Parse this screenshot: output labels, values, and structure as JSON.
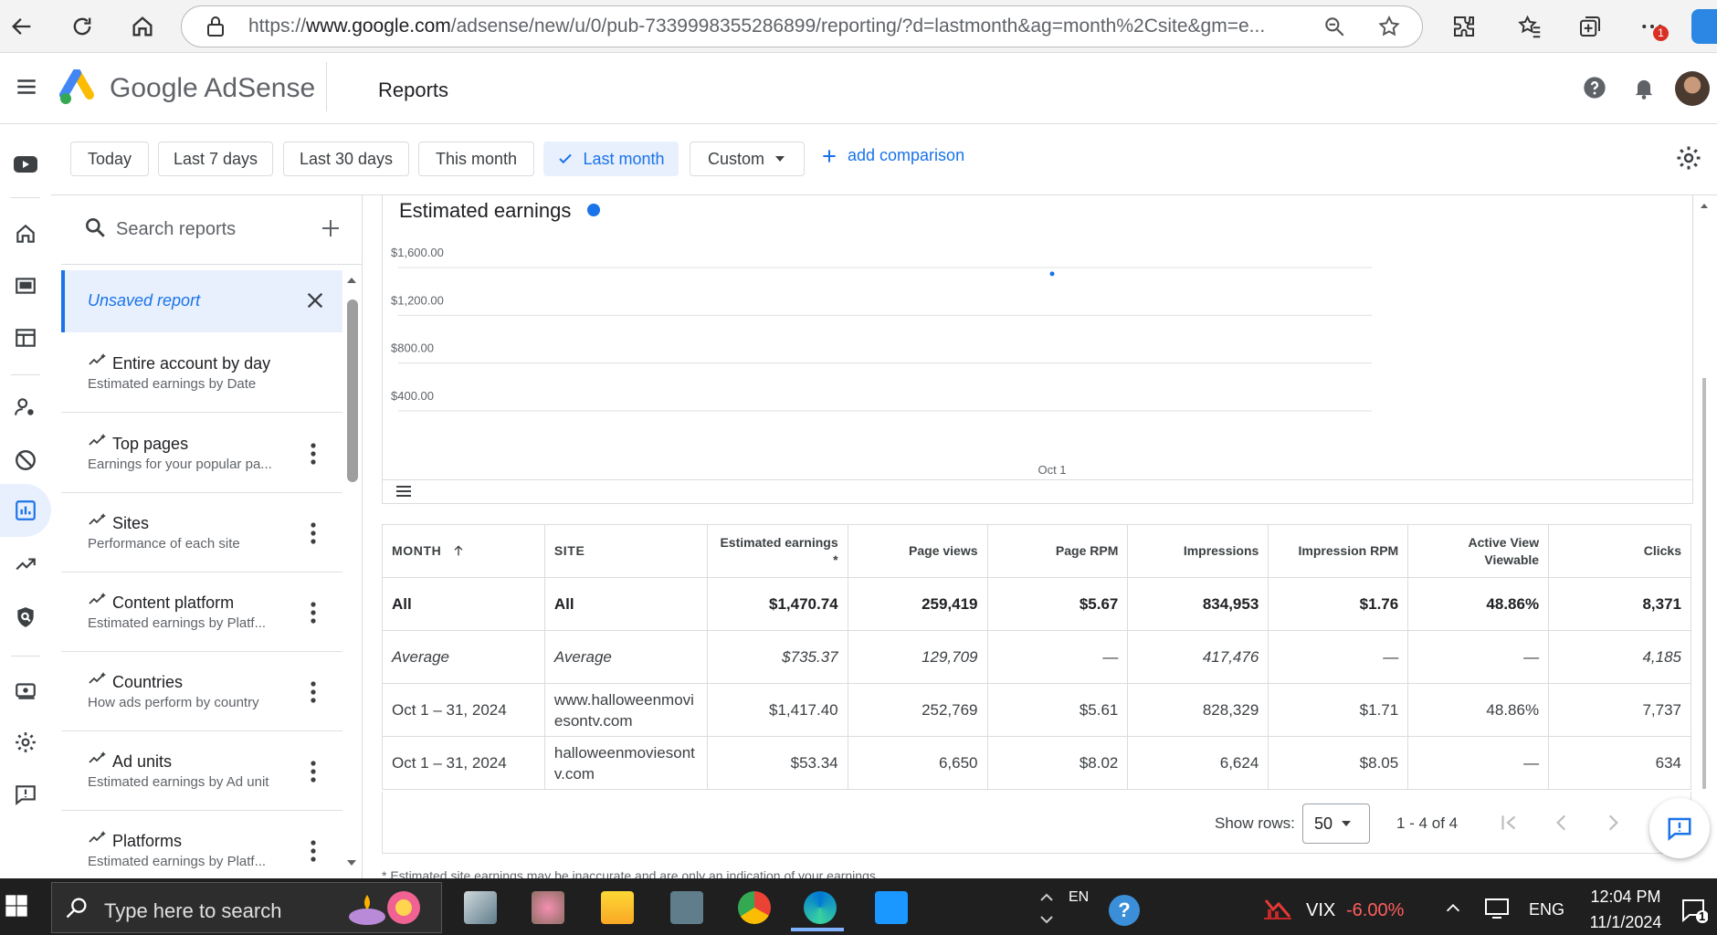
{
  "browser": {
    "url_prefix": "https://",
    "url_domain": "www.google.com",
    "url_path": "/adsense/new/u/0/pub-7339998355286899/reporting/?d=lastmonth&ag=month%2Csite&gm=e...",
    "notification_badge": "1"
  },
  "header": {
    "brand": "Google AdSense",
    "page_title": "Reports"
  },
  "date_chips": [
    "Today",
    "Last 7 days",
    "Last 30 days",
    "This month",
    "Last month",
    "Custom"
  ],
  "active_chip": "Last month",
  "add_comparison": "add comparison",
  "sidebar": {
    "search_placeholder": "Search reports",
    "unsaved_report": "Unsaved report",
    "reports": [
      {
        "title": "Entire account by day",
        "subtitle": "Estimated earnings by Date"
      },
      {
        "title": "Top pages",
        "subtitle": "Earnings for your popular pa..."
      },
      {
        "title": "Sites",
        "subtitle": "Performance of each site"
      },
      {
        "title": "Content platform",
        "subtitle": "Estimated earnings by Platf..."
      },
      {
        "title": "Countries",
        "subtitle": "How ads perform by country"
      },
      {
        "title": "Ad units",
        "subtitle": "Estimated earnings by Ad unit"
      },
      {
        "title": "Platforms",
        "subtitle": "Estimated earnings by Platf..."
      }
    ]
  },
  "chart_data": {
    "type": "scatter",
    "title": "Estimated earnings",
    "series": [
      {
        "color": "#1a73e8",
        "points": [
          {
            "x": "Oct 1",
            "y": 1470.74
          }
        ]
      }
    ],
    "y_ticks": [
      "$1,600.00",
      "$1,200.00",
      "$800.00",
      "$400.00"
    ],
    "y_tick_values": [
      1600,
      1200,
      800,
      400
    ],
    "x_tick_labels": [
      "Oct 1"
    ],
    "ylim": [
      0,
      1600
    ],
    "grid": true
  },
  "table": {
    "columns": [
      "MONTH",
      "SITE",
      "Estimated earnings *",
      "Page views",
      "Page RPM",
      "Impressions",
      "Impression RPM",
      "Active View Viewable",
      "Clicks"
    ],
    "rows": [
      {
        "kind": "total",
        "cells": [
          "All",
          "All",
          "$1,470.74",
          "259,419",
          "$5.67",
          "834,953",
          "$1.76",
          "48.86%",
          "8,371"
        ]
      },
      {
        "kind": "avg",
        "cells": [
          "Average",
          "Average",
          "$735.37",
          "129,709",
          "—",
          "417,476",
          "—",
          "—",
          "4,185"
        ]
      },
      {
        "kind": "data",
        "cells": [
          "Oct 1 – 31, 2024",
          "www.halloweenmoviesontv.com",
          "$1,417.40",
          "252,769",
          "$5.61",
          "828,329",
          "$1.71",
          "48.86%",
          "7,737"
        ]
      },
      {
        "kind": "data",
        "cells": [
          "Oct 1 – 31, 2024",
          "halloweenmoviesontv.com",
          "$53.34",
          "6,650",
          "$8.02",
          "6,624",
          "$8.05",
          "—",
          "634"
        ]
      }
    ],
    "show_rows_label": "Show rows:",
    "rows_per_page": "50",
    "range_label": "1 - 4 of 4",
    "footnote": "* Estimated site earnings may be inaccurate and are only an indication of your earnings."
  },
  "taskbar": {
    "search_placeholder": "Type here to search",
    "input_lang": "EN",
    "ticker": "VIX",
    "ticker_change": "-6.00%",
    "lang": "ENG",
    "time": "12:04 PM",
    "date": "11/1/2024",
    "notif_count": "1"
  }
}
